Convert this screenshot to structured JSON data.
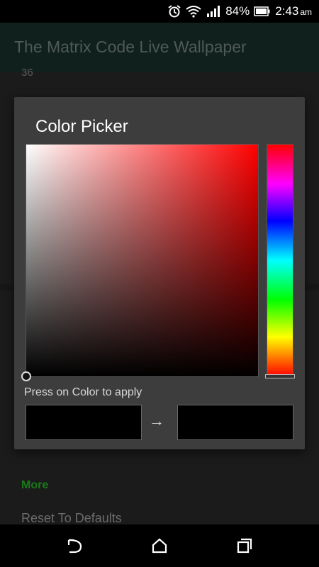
{
  "status_bar": {
    "battery_percent": "84%",
    "time": "2:43",
    "ampm": "am",
    "icons": [
      "alarm-icon",
      "wifi-icon",
      "signal-icon",
      "battery-icon"
    ]
  },
  "app_bar": {
    "title": "The Matrix Code Live Wallpaper"
  },
  "background": {
    "partial_value": "36",
    "section_label": "More",
    "reset_label": "Reset To Defaults"
  },
  "dialog": {
    "title": "Color Picker",
    "hint": "Press on Color to apply",
    "arrow": "→",
    "current_hue": "#ff0000",
    "old_color": "#000000",
    "new_color": "#000000"
  },
  "colors": {
    "app_bar_bg": "#10201c",
    "dialog_bg": "#3d3d3d",
    "accent_green": "#1a7a1a"
  },
  "nav_bar": {
    "icons": [
      "back-icon",
      "home-icon",
      "recent-apps-icon"
    ]
  }
}
